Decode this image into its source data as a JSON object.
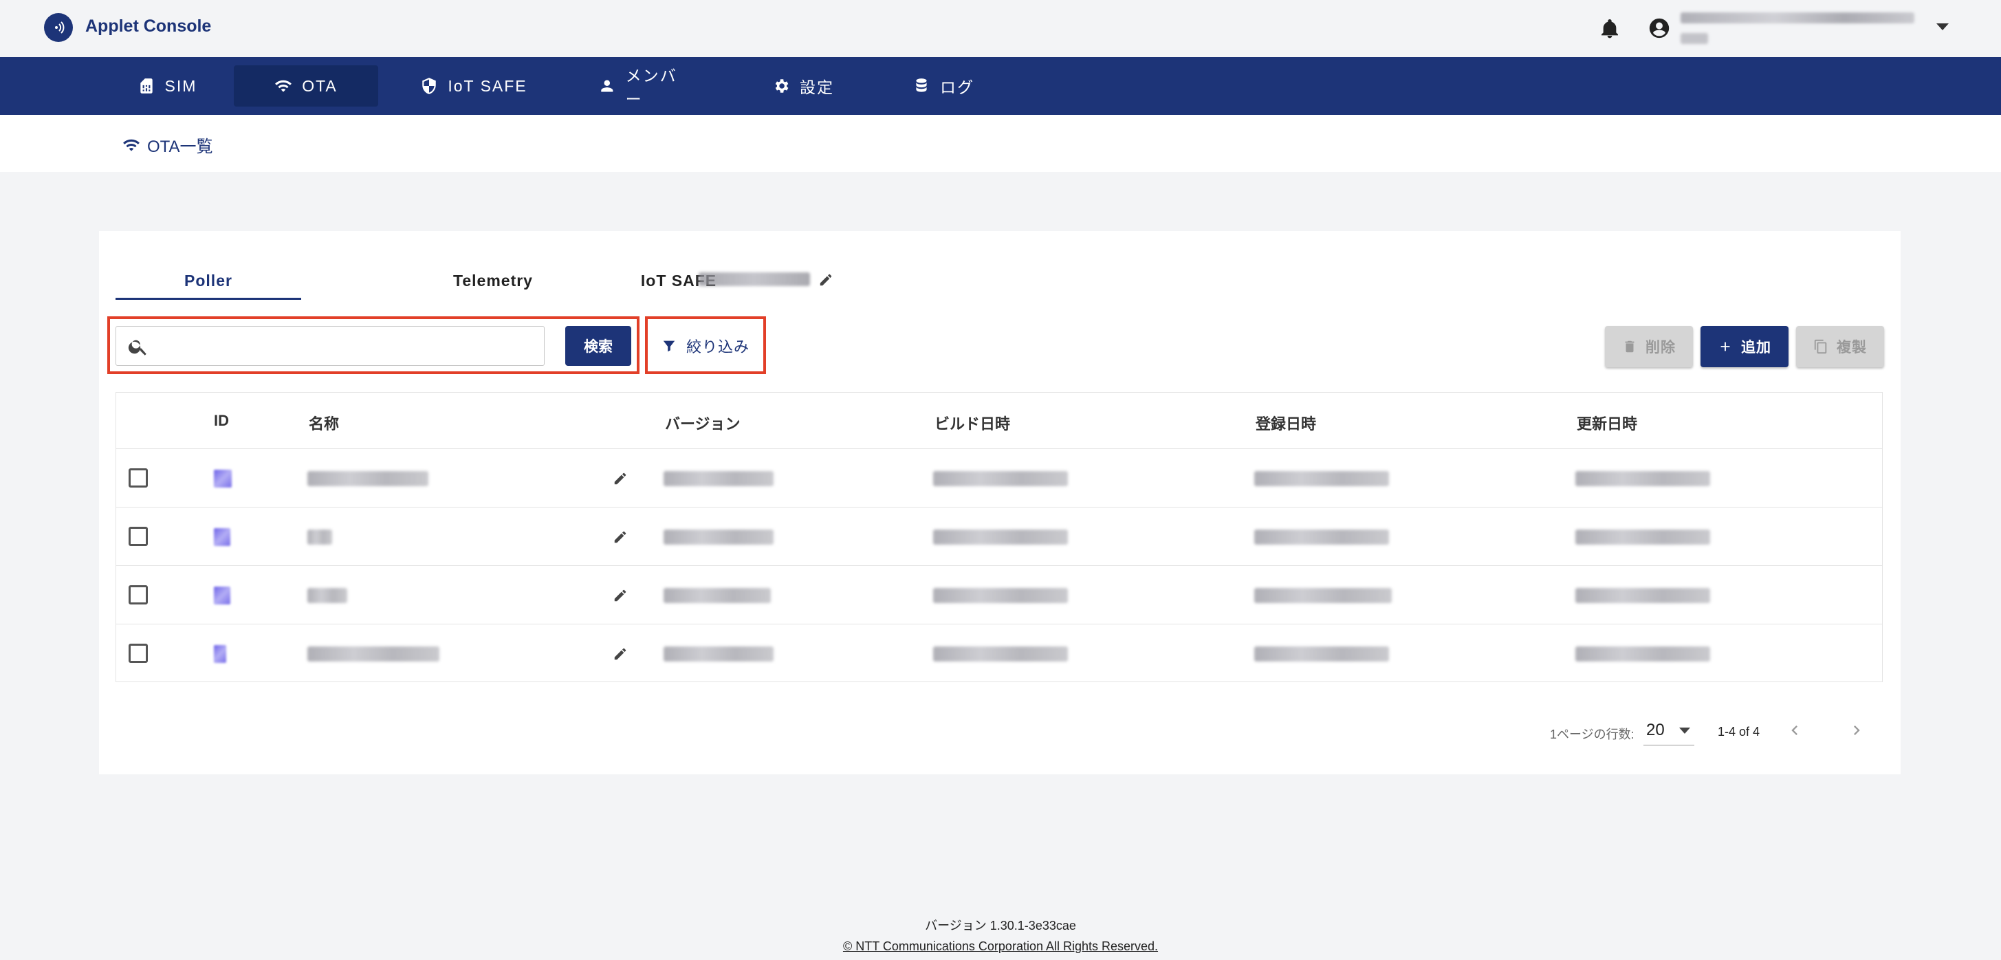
{
  "header": {
    "app_title": "Applet Console",
    "user_name": ""
  },
  "nav": {
    "items": [
      {
        "label": "SIM",
        "icon": "sim-card-icon"
      },
      {
        "label": "OTA",
        "icon": "wifi-icon",
        "active": true
      },
      {
        "label": "IoT SAFE",
        "icon": "shield-icon"
      },
      {
        "label": "メンバー",
        "icon": "person-icon"
      },
      {
        "label": "設定",
        "icon": "gear-icon"
      },
      {
        "label": "ログ",
        "icon": "database-icon"
      }
    ]
  },
  "breadcrumb": {
    "label": "OTA一覧"
  },
  "tabs": [
    {
      "label": "Poller",
      "active": true
    },
    {
      "label": "Telemetry"
    },
    {
      "label": "IoT SAFE"
    }
  ],
  "toolbar": {
    "search_placeholder": "",
    "search_button": "検索",
    "filter_button": "絞り込み",
    "delete_button": "削除",
    "add_button": "追加",
    "copy_button": "複製"
  },
  "table": {
    "columns": [
      "ID",
      "名称",
      "バージョン",
      "ビルド日時",
      "登録日時",
      "更新日時"
    ],
    "rows": [
      {
        "id": "",
        "name": "",
        "version": "",
        "build": "",
        "registered": "",
        "updated": ""
      },
      {
        "id": "",
        "name": "",
        "version": "",
        "build": "",
        "registered": "",
        "updated": ""
      },
      {
        "id": "",
        "name": "",
        "version": "",
        "build": "",
        "registered": "",
        "updated": ""
      },
      {
        "id": "",
        "name": "",
        "version": "",
        "build": "",
        "registered": "",
        "updated": ""
      }
    ]
  },
  "pagination": {
    "rows_per_page_label": "1ページの行数:",
    "rows_per_page": "20",
    "range": "1-4 of 4"
  },
  "footer": {
    "version": "バージョン 1.30.1-3e33cae",
    "copyright": "© NTT Communications Corporation All Rights Reserved."
  },
  "colors": {
    "brand": "#1d3478",
    "highlight": "#e23f28",
    "background": "#f3f4f6"
  }
}
